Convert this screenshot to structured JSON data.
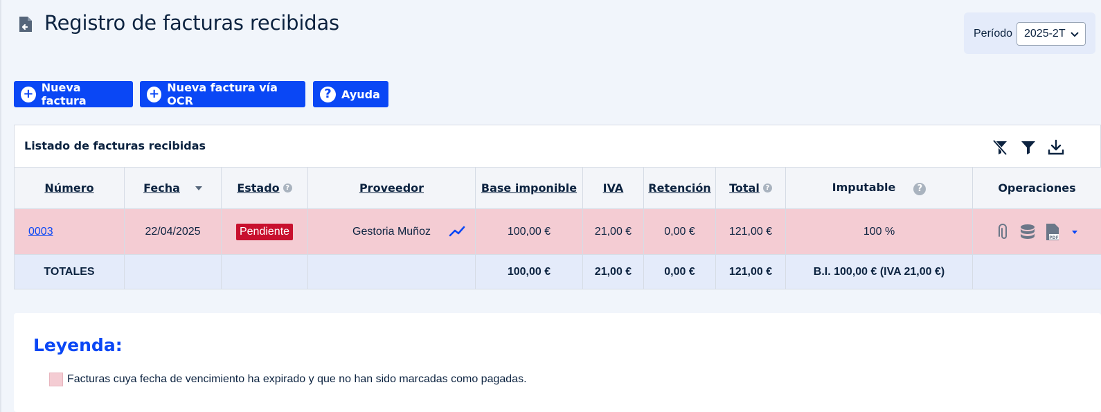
{
  "header": {
    "title": "Registro de facturas recibidas",
    "period_label": "Período",
    "period_value": "2025-2T"
  },
  "toolbar": {
    "new_invoice": "Nueva factura",
    "new_invoice_ocr": "Nueva factura vía OCR",
    "help": "Ayuda"
  },
  "list": {
    "title": "Listado de facturas recibidas",
    "tools": [
      "clear-filter-icon",
      "filter-icon",
      "download-icon"
    ],
    "columns": [
      "Número",
      "Fecha",
      "Estado",
      "Proveedor",
      "Base imponible",
      "IVA",
      "Retención",
      "Total",
      "Imputable",
      "Operaciones"
    ],
    "rows": [
      {
        "numero": "0003",
        "fecha": "22/04/2025",
        "estado": "Pendiente",
        "proveedor": "Gestoria Muñoz",
        "base": "100,00 €",
        "iva": "21,00 €",
        "retencion": "0,00 €",
        "total": "121,00 €",
        "imputable": "100 %"
      }
    ],
    "totals": {
      "label": "TOTALES",
      "base": "100,00 €",
      "iva": "21,00 €",
      "retencion": "0,00 €",
      "total": "121,00 €",
      "imputable": "B.I. 100,00 € (IVA 21,00 €)"
    }
  },
  "legend": {
    "title": "Leyenda:",
    "items": [
      {
        "text": "Facturas cuya fecha de vencimiento ha expirado y que no han sido marcadas como pagadas.",
        "color": "#f4ccd3"
      }
    ]
  },
  "colors": {
    "accent": "#0a47f5",
    "overdue_row": "#f4ccd3",
    "totals_row": "#e4ebfa",
    "badge_pending": "#c8102e"
  }
}
